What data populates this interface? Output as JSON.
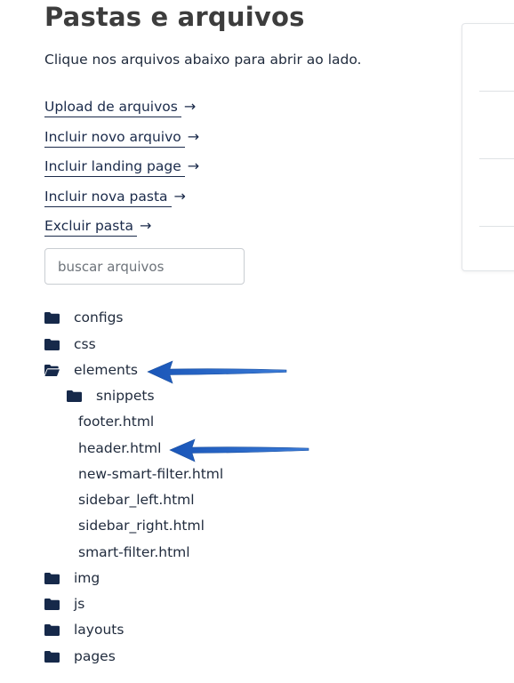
{
  "header": {
    "title": "Pastas e arquivos",
    "subtitle": "Clique nos arquivos abaixo para abrir ao lado."
  },
  "actions": [
    {
      "label": "Upload de arquivos"
    },
    {
      "label": "Incluir novo arquivo"
    },
    {
      "label": "Incluir landing page"
    },
    {
      "label": "Incluir nova pasta"
    },
    {
      "label": "Excluir pasta"
    }
  ],
  "search": {
    "placeholder": "buscar arquivos",
    "value": ""
  },
  "tree": {
    "folders_top": [
      "configs",
      "css"
    ],
    "open_folder": "elements",
    "subfolder": "snippets",
    "files": [
      "footer.html",
      "header.html",
      "new-smart-filter.html",
      "sidebar_left.html",
      "sidebar_right.html",
      "smart-filter.html"
    ],
    "folders_bottom": [
      "img",
      "js",
      "layouts",
      "pages"
    ]
  },
  "icons": {
    "folder": "folder-icon",
    "folder_open": "folder-open-icon",
    "link_arrow": "arrow-right-icon"
  },
  "colors": {
    "folder_icon": "#16294a",
    "annotation_arrow": "#1f5fbf",
    "link_text": "#1a2a4a",
    "title_text": "#3d3d3d"
  }
}
